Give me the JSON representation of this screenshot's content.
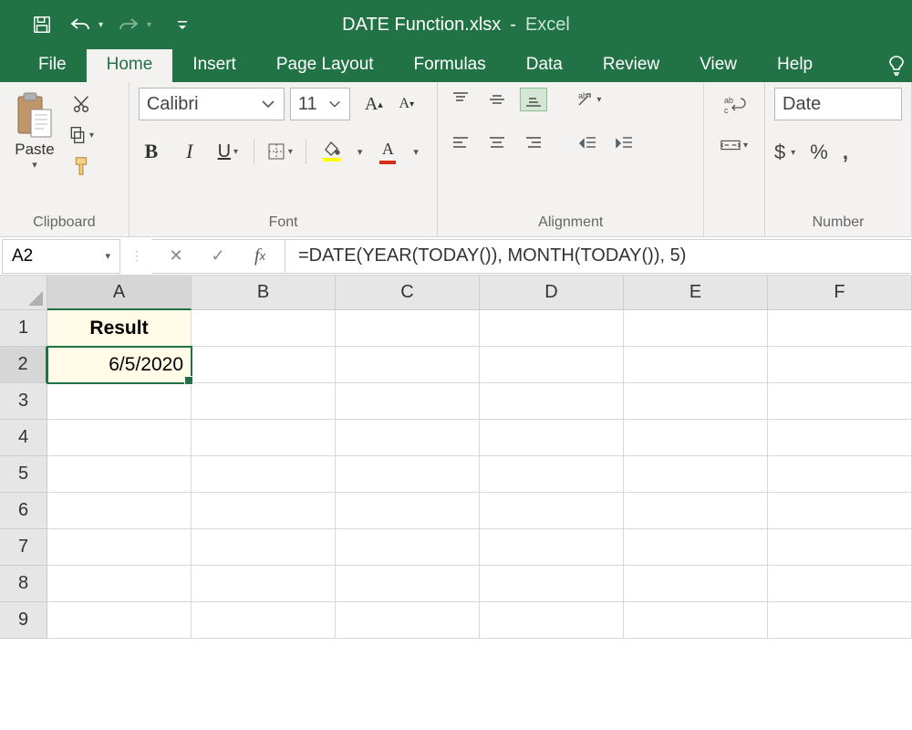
{
  "title": {
    "filename": "DATE Function.xlsx",
    "sep": "-",
    "app": "Excel"
  },
  "tabs": {
    "file": "File",
    "home": "Home",
    "insert": "Insert",
    "page_layout": "Page Layout",
    "formulas": "Formulas",
    "data": "Data",
    "review": "Review",
    "view": "View",
    "help": "Help"
  },
  "ribbon": {
    "clipboard": {
      "paste": "Paste",
      "label": "Clipboard"
    },
    "font": {
      "name": "Calibri",
      "size": "11",
      "label": "Font"
    },
    "alignment": {
      "label": "Alignment"
    },
    "number": {
      "format": "Date",
      "label": "Number",
      "currency": "$",
      "percent": "%",
      "comma": ","
    }
  },
  "formula_bar": {
    "name_box": "A2",
    "formula": "=DATE(YEAR(TODAY()), MONTH(TODAY()), 5)"
  },
  "grid": {
    "columns": [
      "A",
      "B",
      "C",
      "D",
      "E",
      "F"
    ],
    "rows": [
      "1",
      "2",
      "3",
      "4",
      "5",
      "6",
      "7",
      "8",
      "9"
    ],
    "A1": "Result",
    "A2": "6/5/2020"
  }
}
